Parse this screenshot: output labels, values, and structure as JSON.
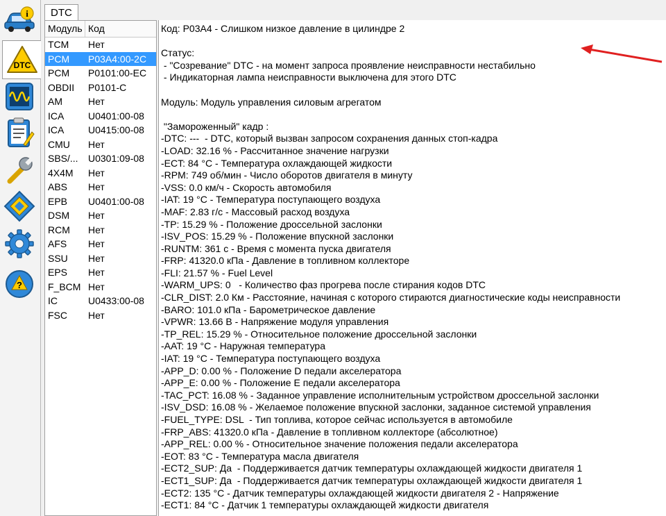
{
  "tab": {
    "label": "DTC"
  },
  "sidebar": {
    "items": [
      {
        "name": "info-car-icon"
      },
      {
        "name": "dtc-warning-icon"
      },
      {
        "name": "oscilloscope-icon"
      },
      {
        "name": "checklist-icon"
      },
      {
        "name": "wrench-icon"
      },
      {
        "name": "chip-icon"
      },
      {
        "name": "gear-icon"
      },
      {
        "name": "help-icon"
      }
    ]
  },
  "modules": {
    "header": {
      "module": "Модуль",
      "code": "Код"
    },
    "rows": [
      {
        "module": "TCM",
        "code": "Нет"
      },
      {
        "module": "PCM",
        "code": "P03A4:00-2C",
        "selected": true
      },
      {
        "module": "PCM",
        "code": "P0101:00-EC"
      },
      {
        "module": "OBDII",
        "code": "P0101-C"
      },
      {
        "module": "AM",
        "code": "Нет"
      },
      {
        "module": "ICA",
        "code": "U0401:00-08"
      },
      {
        "module": "ICA",
        "code": "U0415:00-08"
      },
      {
        "module": "CMU",
        "code": "Нет"
      },
      {
        "module": "SBS/...",
        "code": "U0301:09-08"
      },
      {
        "module": "4X4M",
        "code": "Нет"
      },
      {
        "module": "ABS",
        "code": "Нет"
      },
      {
        "module": "EPB",
        "code": "U0401:00-08"
      },
      {
        "module": "DSM",
        "code": "Нет"
      },
      {
        "module": "RCM",
        "code": "Нет"
      },
      {
        "module": "AFS",
        "code": "Нет"
      },
      {
        "module": "SSU",
        "code": "Нет"
      },
      {
        "module": "EPS",
        "code": "Нет"
      },
      {
        "module": "F_BCM",
        "code": "Нет"
      },
      {
        "module": "IC",
        "code": "U0433:00-08"
      },
      {
        "module": "FSC",
        "code": "Нет"
      }
    ]
  },
  "details": {
    "lines": [
      "Код: P03A4 - Слишком низкое давление в цилиндре 2",
      "",
      "Статус:",
      " - \"Созревание\" DTC - на момент запроса проявление неисправности нестабильно",
      " - Индикаторная лампа неисправности выключена для этого DTC",
      "",
      "Модуль: Модуль управления силовым агрегатом",
      "",
      " \"Замороженный\" кадр :",
      "-DTC: ---  - DTC, который вызван запросом сохранения данных стоп-кадра",
      "-LOAD: 32.16 % - Рассчитанное значение нагрузки",
      "-ECT: 84 °C - Температура охлаждающей жидкости",
      "-RPM: 749 об/мин - Число оборотов двигателя в минуту",
      "-VSS: 0.0 км/ч - Скорость автомобиля",
      "-IAT: 19 °C - Температура поступающего воздуха",
      "-MAF: 2.83 г/с - Массовый расход воздуха",
      "-TP: 15.29 % - Положение дроссельной заслонки",
      "-ISV_POS: 15.29 % - Положение впускной заслонки",
      "-RUNTM: 361 с - Время с момента пуска двигателя",
      "-FRP: 41320.0 кПа - Давление в топливном коллекторе",
      "-FLI: 21.57 % - Fuel Level",
      "-WARM_UPS: 0   - Количество фаз прогрева после стирания кодов DTC",
      "-CLR_DIST: 2.0 Км - Расстояние, начиная с которого стираются диагностические коды неисправности",
      "-BARO: 101.0 кПа - Барометрическое давление",
      "-VPWR: 13.66 В - Напряжение модуля управления",
      "-TP_REL: 15.29 % - Относительное положение дроссельной заслонки",
      "-AAT: 19 °C - Наружная температура",
      "-IAT: 19 °C - Температура поступающего воздуха",
      "-APP_D: 0.00 % - Положение D педали акселератора",
      "-APP_E: 0.00 % - Положение E педали акселератора",
      "-TAC_PCT: 16.08 % - Заданное управление исполнительным устройством дроссельной заслонки",
      "-ISV_DSD: 16.08 % - Желаемое положение впускной заслонки, заданное системой управления",
      "-FUEL_TYPE: DSL  - Тип топлива, которое сейчас используется в автомобиле",
      "-FRP_ABS: 41320.0 кПа - Давление в топливном коллекторе (абсолютное)",
      "-APP_REL: 0.00 % - Относительное значение положения педали акселератора",
      "-EOT: 83 °C - Температура масла двигателя",
      "-ECT2_SUP: Да  - Поддерживается датчик температуры охлаждающей жидкости двигателя 1",
      "-ECT1_SUP: Да  - Поддерживается датчик температуры охлаждающей жидкости двигателя 1",
      "-ECT2: 135 °C - Датчик температуры охлаждающей жидкости двигателя 2 - Напряжение",
      "-ECT1: 84 °C - Датчик 1 температуры охлаждающей жидкости двигателя"
    ]
  },
  "colors": {
    "selection": "#3399ff",
    "annotation_arrow": "#e02020"
  }
}
